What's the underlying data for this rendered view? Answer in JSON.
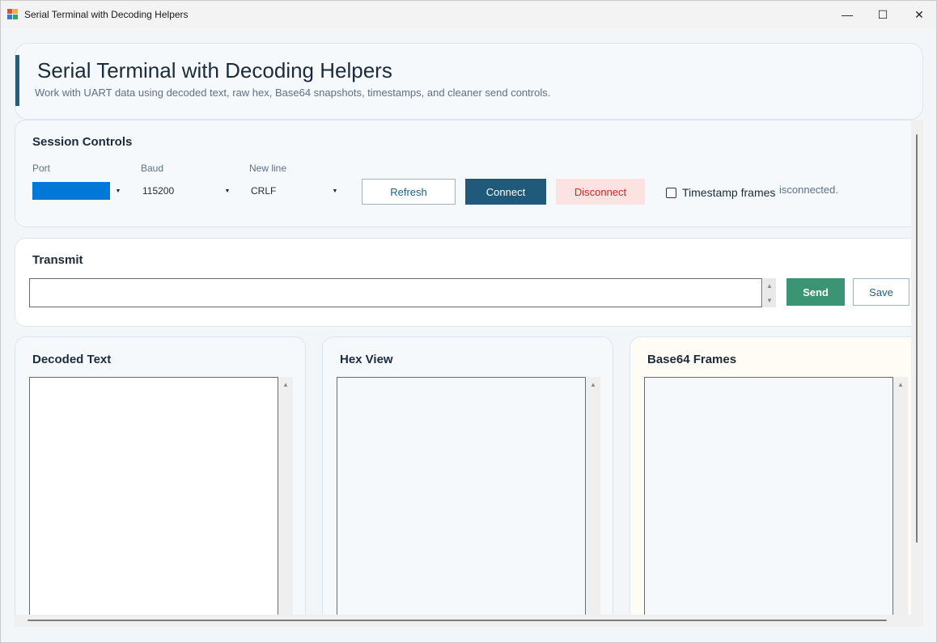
{
  "window": {
    "title": "Serial Terminal with Decoding Helpers",
    "minimize_glyph": "—",
    "maximize_glyph": "☐",
    "close_glyph": "✕"
  },
  "header": {
    "title": "Serial Terminal with Decoding Helpers",
    "subtitle": "Work with UART data using decoded text, raw hex, Base64 snapshots, timestamps, and cleaner send controls."
  },
  "session": {
    "title": "Session Controls",
    "port": {
      "label": "Port",
      "value": ""
    },
    "baud": {
      "label": "Baud",
      "value": "115200"
    },
    "newline": {
      "label": "New line",
      "value": "CRLF"
    },
    "refresh_label": "Refresh",
    "connect_label": "Connect",
    "disconnect_label": "Disconnect",
    "timestamp_label": "Timestamp frames",
    "timestamp_checked": false,
    "status_text": "isconnected."
  },
  "transmit": {
    "title": "Transmit",
    "input_value": "",
    "send_label": "Send",
    "save_label": "Save"
  },
  "panes": {
    "decoded": {
      "title": "Decoded Text"
    },
    "hex": {
      "title": "Hex View"
    },
    "base64": {
      "title": "Base64 Frames"
    }
  },
  "colors": {
    "accent": "#1e5f82",
    "connect_bg": "#1f5a7a",
    "disconnect_bg": "#fde2e2",
    "disconnect_text": "#c62828",
    "send_bg": "#3b9474",
    "port_selected": "#0078d7",
    "base64_pane_bg": "#fffcf5"
  }
}
